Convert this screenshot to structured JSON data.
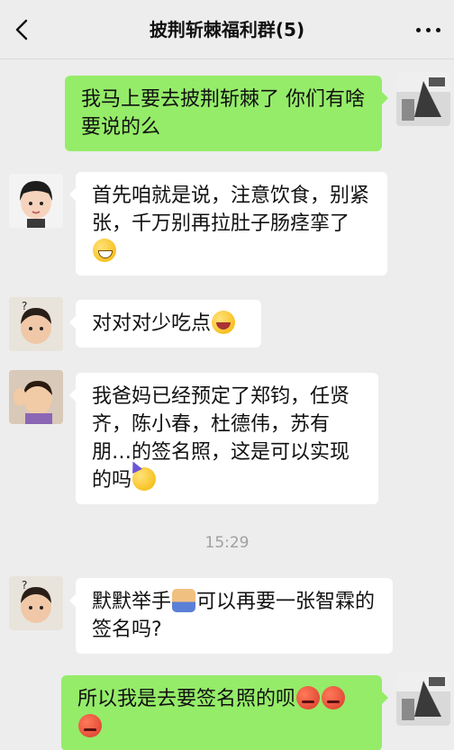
{
  "header": {
    "back_icon": "chevron-left-icon",
    "title": "披荆斩棘福利群(5)",
    "more_icon": "more-dots-icon"
  },
  "messages": [
    {
      "side": "right",
      "avatar": "avatar-self",
      "text": "我马上要去披荆斩棘了 你们有啥要说的么"
    },
    {
      "side": "left",
      "avatar": "avatar-girl-bangs",
      "text": "首先咱就是说，注意饮食，别紧张，千万别再拉肚子肠痉挛了",
      "emoji": "grin-sweat-emoji"
    },
    {
      "side": "left",
      "avatar": "avatar-child-question",
      "text": "对对对少吃点",
      "emoji": "laugh-tears-emoji"
    },
    {
      "side": "left",
      "avatar": "avatar-child-hands",
      "text": "我爸妈已经预定了郑钧，任贤齐，陈小春，杜德伟，苏有朋…的签名照，这是可以实现的吗",
      "emoji": "party-face-emoji"
    },
    {
      "side": "left",
      "avatar": "avatar-child-question",
      "text_before": "默默举手",
      "emoji": "facepalm-emoji",
      "text_after": "可以再要一张智霖的签名吗?"
    },
    {
      "side": "right",
      "avatar": "avatar-self",
      "text": "所以我是去要签名照的呗",
      "emoji": "angry-face-emoji"
    }
  ],
  "timestamp": "15:29"
}
